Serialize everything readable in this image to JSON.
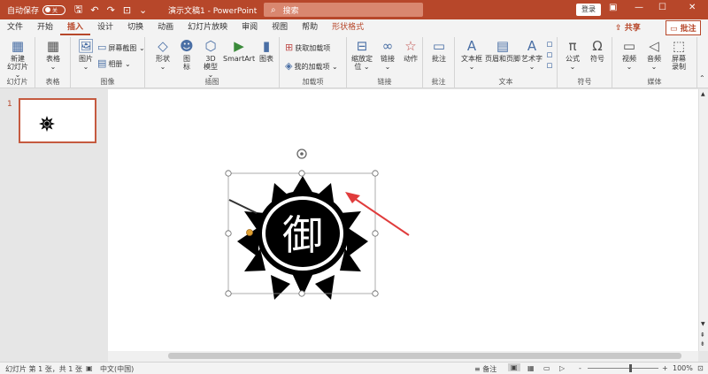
{
  "titlebar": {
    "autosave_label": "自动保存",
    "autosave_state": "关",
    "doc_title": "演示文稿1 - PowerPoint",
    "search_placeholder": "搜索",
    "login_label": "登录",
    "quick_access": [
      "save-icon",
      "undo-icon",
      "redo-icon",
      "present-icon",
      "customize-icon"
    ],
    "window_controls": [
      "ribbon-display-icon",
      "minimize-icon",
      "maximize-icon",
      "close-icon"
    ]
  },
  "tabs": {
    "items": [
      "文件",
      "开始",
      "插入",
      "设计",
      "切换",
      "动画",
      "幻灯片放映",
      "审阅",
      "视图",
      "帮助",
      "形状格式"
    ],
    "active": "插入",
    "share": "共享",
    "comment": "批注"
  },
  "ribbon": {
    "groups": {
      "slides": "幻灯片",
      "tables": "表格",
      "images": "图像",
      "illustrations": "插图",
      "addins": "加载项",
      "links": "链接",
      "comments": "批注",
      "text": "文本",
      "symbols": "符号",
      "media": "媒体"
    },
    "buttons": {
      "new_slide_1": "新建",
      "new_slide_2": "幻灯片 ⌄",
      "table": "表格",
      "table_arrow": "⌄",
      "picture": "图片",
      "picture_arrow": "⌄",
      "screenshot": "屏幕截图 ⌄",
      "album": "相册 ⌄",
      "shapes": "形状",
      "shapes_arrow": "⌄",
      "icons_1": "图",
      "icons_2": "标",
      "model_1": "3D",
      "model_2": "模型",
      "model_arrow": "⌄",
      "smartart": "SmartArt",
      "chart": "图表",
      "get_addins": "获取加载项",
      "my_addins": "我的加载项 ⌄",
      "zoom_1": "缩放定",
      "zoom_2": "位 ⌄",
      "link": "链接",
      "link_arrow": "⌄",
      "action": "动作",
      "comment": "批注",
      "textbox": "文本框",
      "textbox_arrow": "⌄",
      "header_footer": "页眉和页脚",
      "wordart": "艺术字",
      "wordart_arrow": "⌄",
      "equation": "公式",
      "equation_arrow": "⌄",
      "symbol": "符号",
      "video": "视频",
      "video_arrow": "⌄",
      "audio": "音频",
      "audio_arrow": "⌄",
      "screen_rec_1": "屏幕",
      "screen_rec_2": "录制"
    }
  },
  "thumbnail": {
    "slide_number": "1"
  },
  "slide": {
    "glyph": "御"
  },
  "statusbar": {
    "slide_info": "幻灯片 第 1 张，共 1 张",
    "language": "中文(中国)",
    "notes": "备注",
    "zoom_minus": "-",
    "zoom_plus": "+",
    "zoom": "100%"
  }
}
